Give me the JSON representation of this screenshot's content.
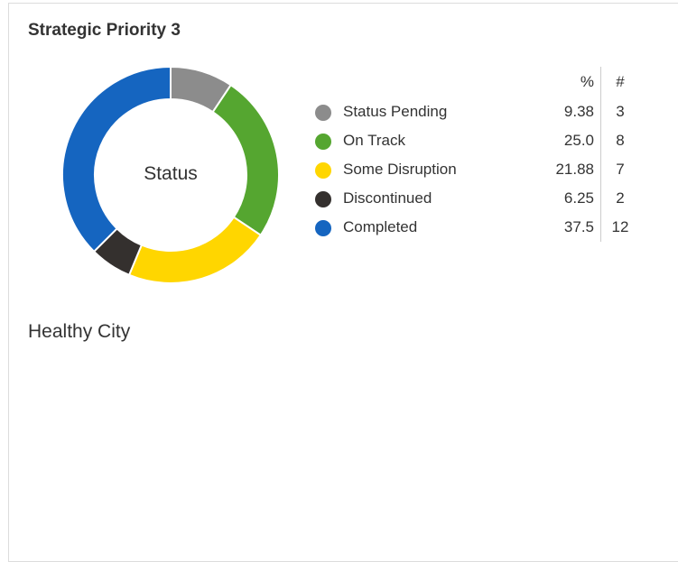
{
  "card": {
    "title": "Strategic Priority 3",
    "subtitle": "Healthy City"
  },
  "legend": {
    "pct_header": "%",
    "count_header": "#",
    "rows": [
      {
        "label": "Status Pending",
        "pct": "9.38",
        "count": "3"
      },
      {
        "label": "On Track",
        "pct": "25.0",
        "count": "8"
      },
      {
        "label": "Some Disruption",
        "pct": "21.88",
        "count": "7"
      },
      {
        "label": "Discontinued",
        "pct": "6.25",
        "count": "2"
      },
      {
        "label": "Completed",
        "pct": "37.5",
        "count": "12"
      }
    ]
  },
  "chart_data": {
    "type": "pie",
    "style": "donut",
    "center_label": "Status",
    "categories": [
      "Status Pending",
      "On Track",
      "Some Disruption",
      "Discontinued",
      "Completed"
    ],
    "values": [
      9.38,
      25.0,
      21.88,
      6.25,
      37.5
    ],
    "counts": [
      3,
      8,
      7,
      2,
      12
    ],
    "colors": [
      "#8c8c8c",
      "#55a630",
      "#ffd600",
      "#34302e",
      "#1565c0"
    ],
    "legend_position": "right"
  }
}
